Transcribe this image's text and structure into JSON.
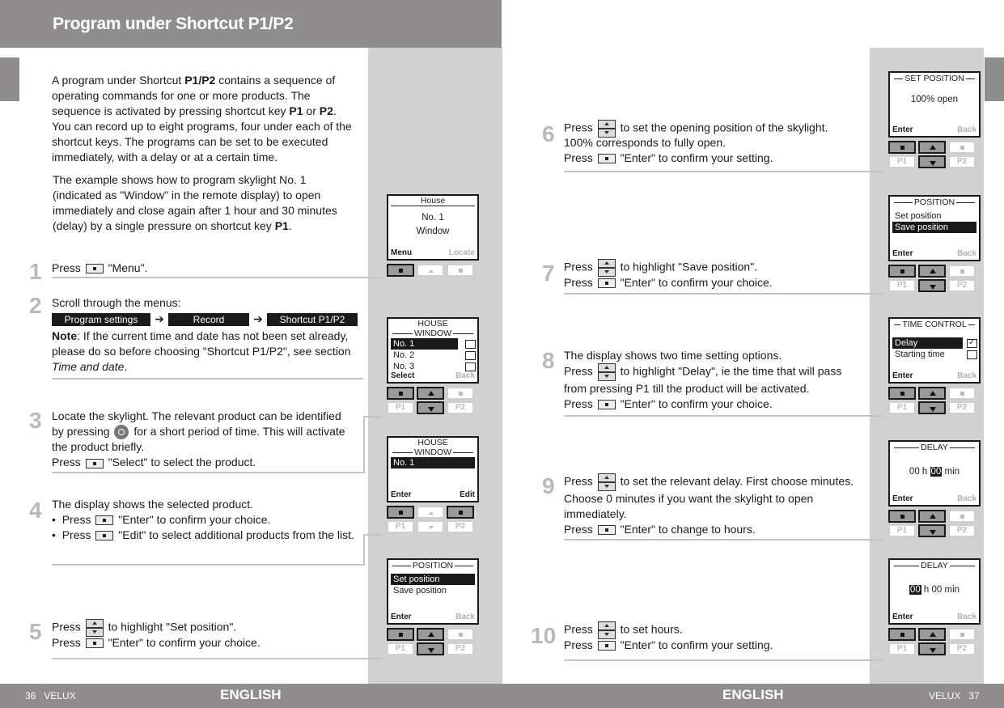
{
  "header": {
    "title": "Program under Shortcut P1/P2"
  },
  "intro": {
    "p1_parts": [
      "A program under Shortcut ",
      "P1/P2",
      " contains a sequence of operating commands for one or more products. The sequence is activated by pressing shortcut key ",
      "P1",
      " or ",
      "P2",
      ". You can record up to eight programs, four under each of the shortcut keys. The programs can be set to be executed immediately, with a delay or at a certain time."
    ],
    "p2_parts": [
      "The example shows how to program skylight No. 1 (indicated as \"Window\" in the remote display) to open immediately and close again after 1 hour and 30 minutes (delay) by a single pressure on shortcut key ",
      "P1",
      "."
    ]
  },
  "steps": [
    {
      "num": "1",
      "lines": [
        {
          "pre": "Press",
          "icon": "select-key",
          "post": "\"Menu\"."
        }
      ]
    },
    {
      "num": "2",
      "intro": "Scroll through the menus:",
      "menu_path": [
        "Program settings",
        "Record",
        "Shortcut P1/P2"
      ],
      "note_label": "Note",
      "note_text": ": If the current time and date has not been set already, please do so before choosing \"Shortcut P1/P2\", see section ",
      "note_ref": "Time and date",
      "note_end": "."
    },
    {
      "num": "3",
      "text_a": "Locate the skylight. The relevant product can be identified by pressing",
      "text_b": "for a short period of time. This will activate the product briefly.",
      "lines": [
        {
          "pre": "Press",
          "icon": "select-key",
          "post": "\"Select\" to select the product."
        }
      ]
    },
    {
      "num": "4",
      "intro": "The display shows the selected product.",
      "bullets": [
        {
          "pre": "Press",
          "icon": "select-key",
          "post": "\"Enter\" to confirm your choice."
        },
        {
          "pre": "Press",
          "icon": "select-key",
          "post": "\"Edit\" to select additional products from the list."
        }
      ]
    },
    {
      "num": "5",
      "lines": [
        {
          "pre": "Press",
          "icon": "up-down-key",
          "post": "to highlight \"Set position\"."
        },
        {
          "pre": "Press",
          "icon": "select-key",
          "post": "\"Enter\" to confirm your choice."
        }
      ]
    },
    {
      "num": "6",
      "lines": [
        {
          "pre": "Press",
          "icon": "up-down-key",
          "post": "to set the opening position of the skylight."
        },
        {
          "pre": "",
          "icon": "",
          "post": "100% corresponds to fully open."
        },
        {
          "pre": "Press",
          "icon": "select-key",
          "post": "\"Enter\" to confirm your setting."
        }
      ]
    },
    {
      "num": "7",
      "lines": [
        {
          "pre": "Press",
          "icon": "up-down-key",
          "post": "to highlight \"Save position\"."
        },
        {
          "pre": "Press",
          "icon": "select-key",
          "post": "\"Enter\" to confirm your choice."
        }
      ]
    },
    {
      "num": "8",
      "intro": "The display shows two time setting options.",
      "lines": [
        {
          "pre": "Press",
          "icon": "up-down-key",
          "post": "to highlight \"Delay\", ie the time that will pass from pressing P1 till the product will be activated."
        },
        {
          "pre": "Press",
          "icon": "select-key",
          "post": "\"Enter\" to confirm your choice."
        }
      ]
    },
    {
      "num": "9",
      "lines": [
        {
          "pre": "Press",
          "icon": "up-down-key",
          "post": "to set the relevant delay. First choose minutes. Choose 0 minutes if you want the skylight to open immediately."
        },
        {
          "pre": "Press",
          "icon": "select-key",
          "post": "\"Enter\" to change to hours."
        }
      ]
    },
    {
      "num": "10",
      "lines": [
        {
          "pre": "Press",
          "icon": "up-down-key",
          "post": "to set hours."
        },
        {
          "pre": "Press",
          "icon": "select-key",
          "post": "\"Enter\" to confirm your setting."
        }
      ]
    }
  ],
  "displays": {
    "d1": {
      "title": "House",
      "center": [
        "No. 1",
        "Window"
      ],
      "soft_left": "Menu",
      "soft_right": "Locate"
    },
    "d2": {
      "title": "HOUSE",
      "subtitle": "WINDOW",
      "rows": [
        {
          "label": "No. 1",
          "highlight": true
        },
        {
          "label": "No. 2"
        },
        {
          "label": "No. 3"
        }
      ],
      "soft_left": "Select",
      "soft_right": "Back"
    },
    "d3": {
      "title": "HOUSE",
      "subtitle": "WINDOW",
      "rows": [
        {
          "label": "No. 1",
          "highlight": true
        }
      ],
      "soft_left": "Enter",
      "soft_right": "Edit"
    },
    "d4": {
      "subtitle": "POSITION",
      "rows": [
        {
          "label": "Set position",
          "highlight": true
        },
        {
          "label": "Save position"
        }
      ],
      "soft_left": "Enter",
      "soft_right": "Back"
    },
    "d5": {
      "subtitle": "SET POSITION",
      "center": [
        "100% open"
      ],
      "soft_left": "Enter",
      "soft_right": "Back"
    },
    "d6": {
      "subtitle": "POSITION",
      "rows": [
        {
          "label": "Set position"
        },
        {
          "label": "Save position",
          "highlight": true
        }
      ],
      "soft_left": "Enter",
      "soft_right": "Back"
    },
    "d7": {
      "subtitle": "TIME CONTROL",
      "rows": [
        {
          "label": "Delay",
          "highlight": true,
          "checked": true
        },
        {
          "label": "Starting time",
          "checked": false
        }
      ],
      "soft_left": "Enter",
      "soft_right": "Back"
    },
    "d8": {
      "subtitle": "DELAY",
      "hours": "00",
      "h_label": "h",
      "minutes": "00",
      "m_label": "min",
      "active_field": "minutes",
      "soft_left": "Enter",
      "soft_right": "Back"
    },
    "d9": {
      "subtitle": "DELAY",
      "hours": "00",
      "h_label": "h",
      "minutes": "00",
      "m_label": "min",
      "active_field": "hours",
      "soft_left": "Enter",
      "soft_right": "Back"
    },
    "keypad_labels": {
      "p1": "P1",
      "p2": "P2"
    }
  },
  "footer": {
    "left": "36   VELUX",
    "right": "VELUX   37",
    "lang_left": "ENGLISH",
    "lang_right": "ENGLISH"
  },
  "colors": {
    "bar": "#8f8d8e",
    "column": "#d1d1d1",
    "step_number": "#b9b9b9",
    "rule": "#c4c4c4"
  }
}
